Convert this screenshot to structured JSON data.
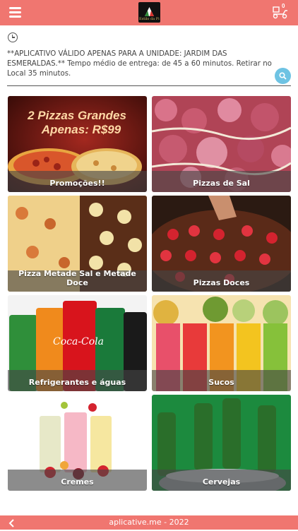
{
  "header": {
    "logo_text": "Estilo da Pizza",
    "cart_count": "0"
  },
  "notice": {
    "text": "**APLICATIVO VÁLIDO APENAS PARA A UNIDADE: JARDIM DAS ESMERALDAS.** Tempo médio de entrega: de 45 a 60 minutos. Retirar no Local 35 minutos."
  },
  "categories": [
    {
      "label": "Promoções!!",
      "image_text": "2 Pizzas Grandes Apenas: R$99"
    },
    {
      "label": "Pizzas de Sal"
    },
    {
      "label": "Pizza Metade Sal e Metade Doce"
    },
    {
      "label": "Pizzas Doces"
    },
    {
      "label": "Refrigerantes e águas"
    },
    {
      "label": "Sucos"
    },
    {
      "label": "Cremes"
    },
    {
      "label": "Cervejas"
    }
  ],
  "footer": {
    "text": "aplicative.me - 2022"
  },
  "colors": {
    "header": "#f07670",
    "search": "#6ec3e3"
  }
}
